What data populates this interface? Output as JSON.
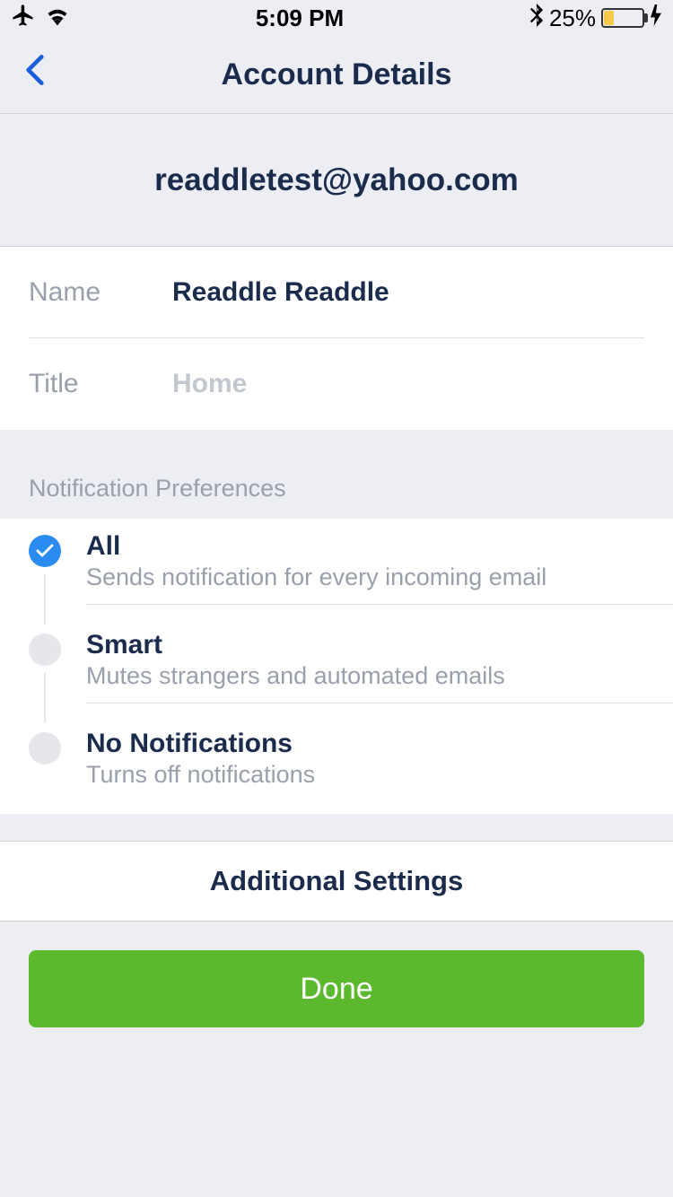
{
  "statusBar": {
    "time": "5:09 PM",
    "batteryPercent": "25%"
  },
  "header": {
    "title": "Account Details"
  },
  "account": {
    "email": "readdletest@yahoo.com",
    "nameLabel": "Name",
    "nameValue": "Readdle Readdle",
    "titleLabel": "Title",
    "titlePlaceholder": "Home"
  },
  "notifications": {
    "sectionTitle": "Notification Preferences",
    "options": [
      {
        "title": "All",
        "desc": "Sends notification for every incoming email",
        "selected": true
      },
      {
        "title": "Smart",
        "desc": "Mutes strangers and automated emails",
        "selected": false
      },
      {
        "title": "No Notifications",
        "desc": "Turns off notifications",
        "selected": false
      }
    ]
  },
  "additional": {
    "label": "Additional Settings"
  },
  "doneButton": {
    "label": "Done"
  }
}
